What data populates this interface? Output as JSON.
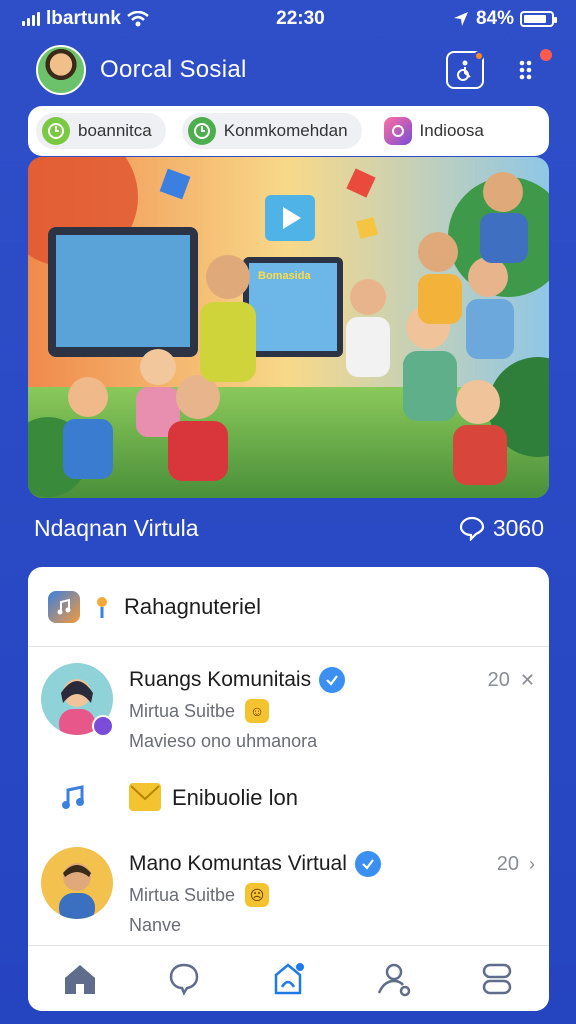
{
  "status_bar": {
    "carrier": "lbartunk",
    "time": "22:30",
    "battery": "84%",
    "battery_level": 0.84
  },
  "header": {
    "title": "Oorcal Sosial",
    "icons": [
      "profile-avatar",
      "accessibility-icon",
      "apps-menu-icon"
    ]
  },
  "filters": [
    {
      "label": "boannitca",
      "icon": "clock-icon",
      "color": "#7ac943"
    },
    {
      "label": "Konmkomehdan",
      "icon": "clock-icon",
      "color": "#4cae4c"
    },
    {
      "label": "Indioosa",
      "icon": "gallery-icon",
      "color": "#7a4cd8"
    }
  ],
  "hero": {
    "caption": "Ndaqnan Virtula",
    "comment_count": "3060",
    "poster_text": "Bomasida"
  },
  "panel": {
    "title": "Rahagnuteriel",
    "items": [
      {
        "title": "Ruangs Komunitais",
        "subtitle": "Mirtua Suitbe",
        "meta": "Mavieso ono uhmanora",
        "count": "20",
        "avatar_color": "#8fd3d8"
      },
      {
        "title": "Enibuolie lon",
        "subtitle": "",
        "meta": "",
        "count": ""
      },
      {
        "title": "Mano Komuntas Virtual",
        "subtitle": "Mirtua Suitbe",
        "meta": "Nanve",
        "count": "20",
        "avatar_color": "#f2c14e"
      }
    ]
  },
  "tabs": [
    "home-tab",
    "chat-tab",
    "community-tab",
    "profile-tab",
    "settings-tab"
  ],
  "colors": {
    "background": "#2f4fc9",
    "verified": "#3a8ff0",
    "notification": "#ff5a4e",
    "active_tab": "#1e7ae8"
  }
}
